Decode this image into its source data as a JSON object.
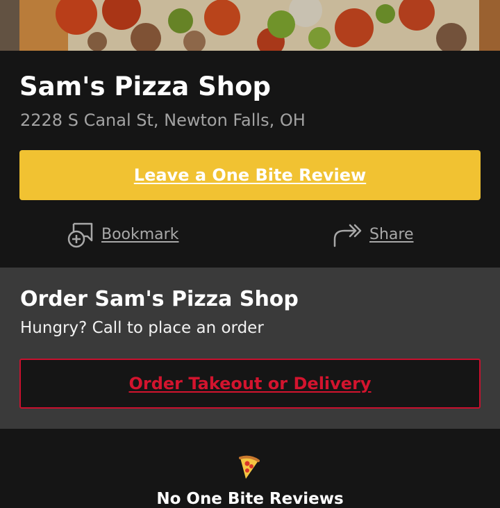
{
  "shop": {
    "name": "Sam's Pizza Shop",
    "address": "2228 S Canal St, Newton Falls, OH"
  },
  "actions": {
    "review_label": "Leave a One Bite Review",
    "bookmark_label": "Bookmark",
    "bookmark_icon": "bookmark-add-icon",
    "share_label": "Share",
    "share_icon": "share-arrow-icon"
  },
  "order": {
    "title": "Order Sam's Pizza Shop",
    "subtitle": "Hungry? Call to place an order",
    "button_label": "Order Takeout or Delivery"
  },
  "reviews": {
    "icon": "pizza-slice-icon",
    "empty_label": "No One Bite Reviews"
  },
  "colors": {
    "review_button": "#f1c232",
    "order_accent": "#c8102e",
    "background": "#151515",
    "order_background": "#3a3a3a"
  }
}
